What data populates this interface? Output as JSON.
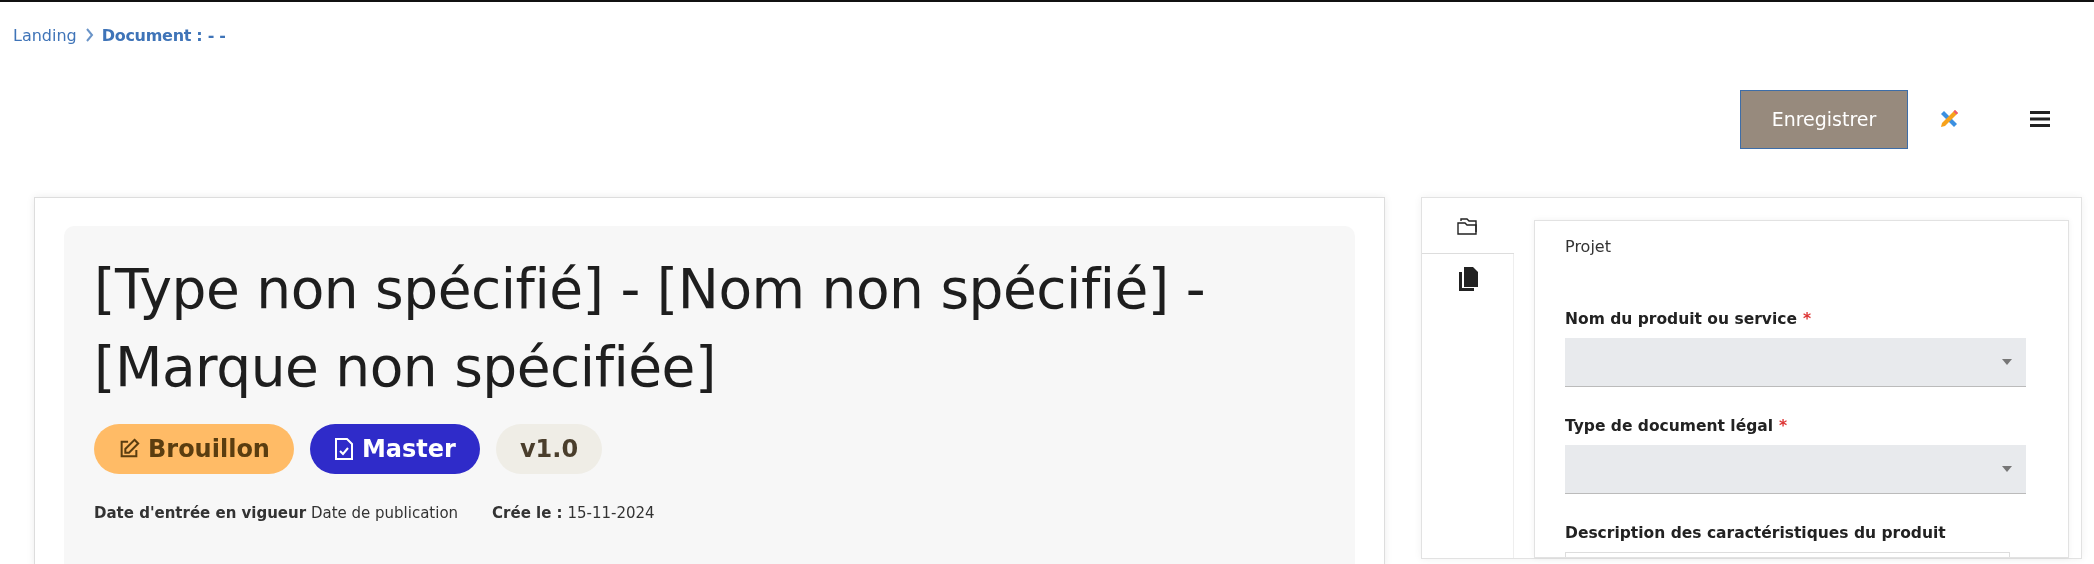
{
  "breadcrumb": [
    {
      "label": "Landing",
      "current": false
    },
    {
      "label": "Document : - -",
      "current": true
    }
  ],
  "toolbar": {
    "save_button": "Enregistrer"
  },
  "document": {
    "title": "[Type non spécifié] - [Nom non spécifié] - [Marque non spécifiée]",
    "badges": [
      {
        "kind": "status",
        "label": "Brouillon"
      },
      {
        "kind": "master",
        "label": "Master"
      },
      {
        "kind": "version",
        "label": "v1.0"
      }
    ],
    "meta": [
      {
        "label": "Date d'entrée en vigueur",
        "value": "Date de publication"
      },
      {
        "label": "Crée le :",
        "value": "15-11-2024"
      }
    ]
  },
  "side_tabs": [
    {
      "kind": "folders",
      "selected": true
    },
    {
      "kind": "copies",
      "selected": false
    }
  ],
  "form": {
    "section": "Projet",
    "fields": [
      {
        "kind": "select",
        "label": "Nom du produit ou service",
        "required_mark": "*"
      },
      {
        "kind": "select",
        "label": "Type de document légal",
        "required_mark": "*"
      },
      {
        "kind": "textarea",
        "label": "Description des caractéristiques du produit"
      }
    ]
  }
}
